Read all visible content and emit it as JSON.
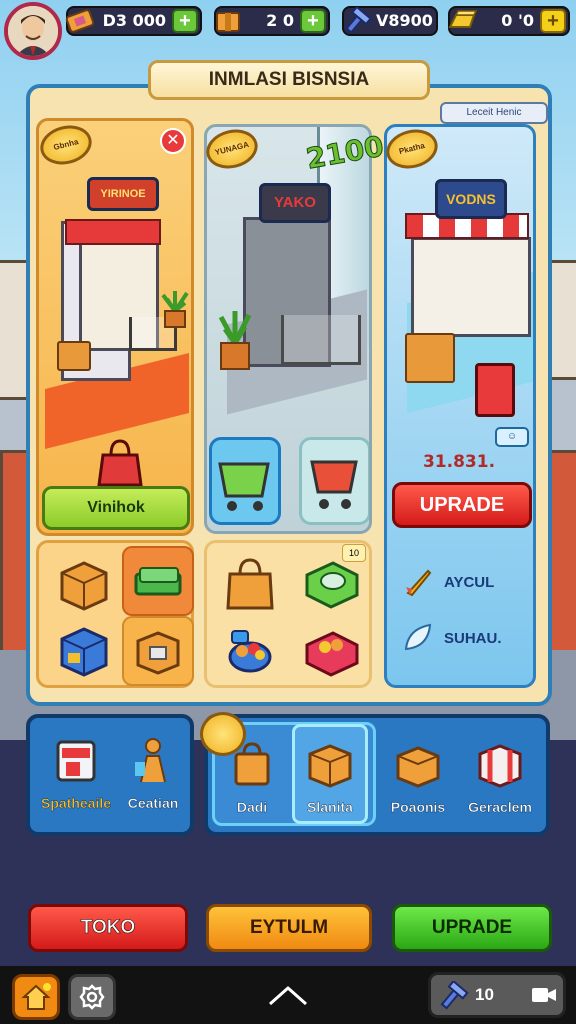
{
  "resources": [
    {
      "icon": "ticket-icon",
      "value": "D3 000",
      "add": "+"
    },
    {
      "icon": "crate-icon",
      "value": "2 0",
      "add": "+"
    },
    {
      "icon": "hammer-icon",
      "value": "V8900",
      "add": ""
    },
    {
      "icon": "gold-bar-icon",
      "value": "0 '0",
      "add": "+"
    }
  ],
  "title": "INMLASI BISNSIA",
  "panel_tag": "Leceit Henic",
  "cards": [
    {
      "badge": "Gbnha",
      "sign": "YIRINOE",
      "button": "Vinihok"
    },
    {
      "badge": "YUNAGA",
      "sign": "YAKO",
      "price": "2100"
    },
    {
      "badge": "Pkatha",
      "sign": "VODNS",
      "amount": "31.831.",
      "button": "UPRADE",
      "options": [
        "AYCUL",
        "SUHAU."
      ]
    }
  ],
  "small_tag": "10",
  "menu_left": [
    {
      "label": "Spatheaile",
      "icon": "store-icon"
    },
    {
      "label": "Ceatian",
      "icon": "worker-icon"
    }
  ],
  "menu_right": [
    {
      "label": "Dadi",
      "icon": "bag-box-icon"
    },
    {
      "label": "Slanita",
      "icon": "box-icon"
    },
    {
      "label": "Poaonis",
      "icon": "package-icon"
    },
    {
      "label": "Geraclem",
      "icon": "gift-box-icon"
    }
  ],
  "actions": [
    "TOKO",
    "EYTULM",
    "UPRADE"
  ],
  "nav": {
    "resource_value": "10"
  },
  "colors": {
    "accent_blue": "#2a78c2",
    "red": "#d41a1a",
    "green": "#2aa814",
    "orange": "#f08a12",
    "gold": "#f0b020"
  }
}
